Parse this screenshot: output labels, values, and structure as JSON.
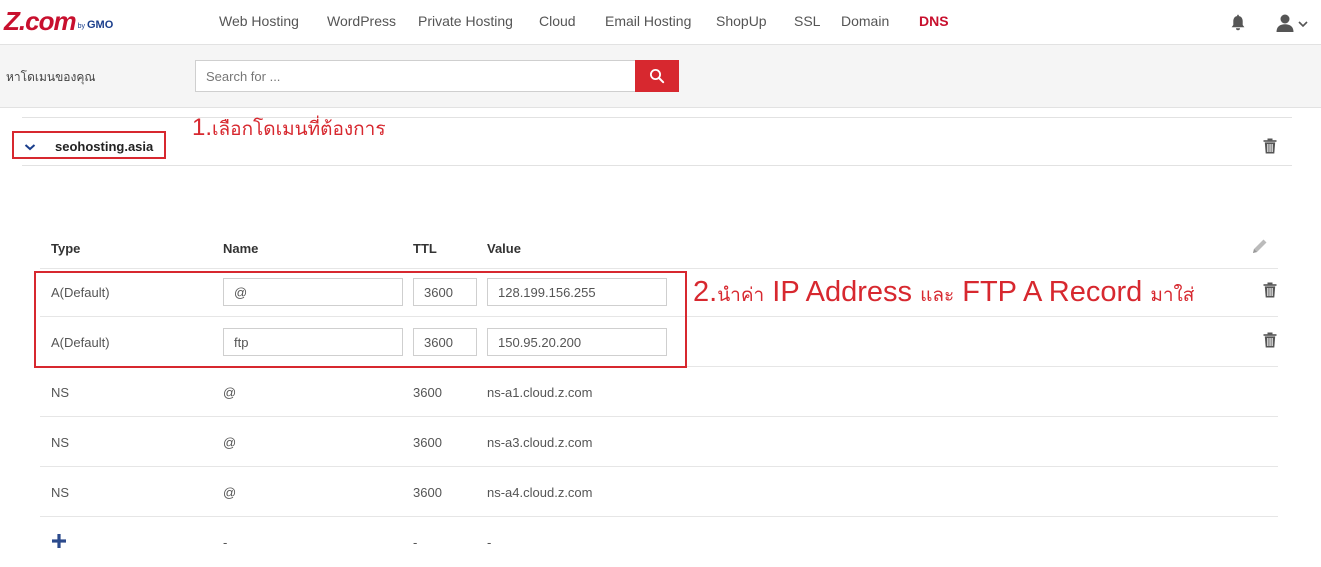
{
  "brand": {
    "logo_main": "Z.com",
    "logo_by": "by",
    "logo_gmo": "GMO"
  },
  "nav": {
    "items": [
      {
        "label": "Web Hosting",
        "active": false
      },
      {
        "label": "WordPress",
        "active": false
      },
      {
        "label": "Private Hosting",
        "active": false
      },
      {
        "label": "Cloud",
        "active": false
      },
      {
        "label": "Email Hosting",
        "active": false
      },
      {
        "label": "ShopUp",
        "active": false
      },
      {
        "label": "SSL",
        "active": false
      },
      {
        "label": "Domain",
        "active": false
      },
      {
        "label": "DNS",
        "active": true
      }
    ],
    "icons": [
      "bell-icon",
      "user-icon",
      "chevron-down-icon"
    ]
  },
  "search": {
    "label": "หาโดเมนของคุณ",
    "placeholder": "Search for ...",
    "value": "",
    "button_icon": "search-icon"
  },
  "domain": {
    "name": "seohosting.asia",
    "expanded": true
  },
  "annotations": {
    "step1": {
      "number": "1.",
      "text": "เลือกโดเมนที่ต้องการ"
    },
    "step2": {
      "number": "2.",
      "thai_prefix": "นำค่า",
      "en1": "IP Address",
      "thai_mid": "และ",
      "en2": "FTP A Record",
      "thai_suffix": "มาใส่"
    }
  },
  "table": {
    "headers": {
      "type": "Type",
      "name": "Name",
      "ttl": "TTL",
      "value": "Value"
    },
    "editable_rows": [
      {
        "type": "A(Default)",
        "name": "@",
        "ttl": "3600",
        "value": "128.199.156.255"
      },
      {
        "type": "A(Default)",
        "name": "ftp",
        "ttl": "3600",
        "value": "150.95.20.200"
      }
    ],
    "static_rows": [
      {
        "type": "NS",
        "name": "@",
        "ttl": "3600",
        "value": "ns-a1.cloud.z.com"
      },
      {
        "type": "NS",
        "name": "@",
        "ttl": "3600",
        "value": "ns-a3.cloud.z.com"
      },
      {
        "type": "NS",
        "name": "@",
        "ttl": "3600",
        "value": "ns-a4.cloud.z.com"
      }
    ],
    "new_row": {
      "name": "-",
      "ttl": "-",
      "value": "-"
    }
  },
  "colors": {
    "accent": "#d7282f",
    "brand_red": "#c8102e",
    "brand_blue": "#1a3e8c",
    "icon_gray": "#555555"
  }
}
